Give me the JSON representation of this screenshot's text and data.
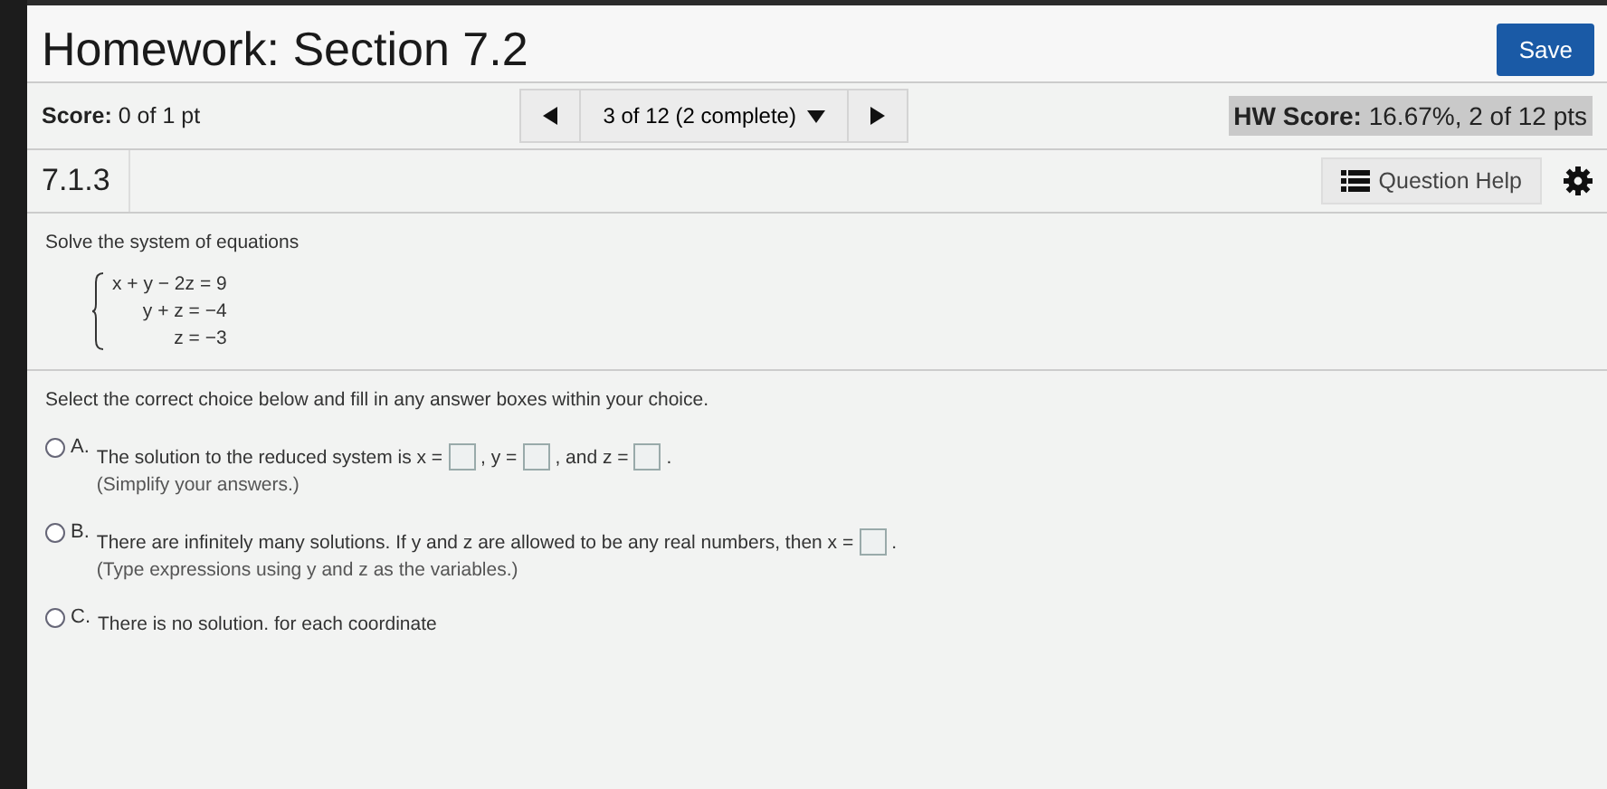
{
  "header": {
    "title": "Homework: Section 7.2",
    "save": "Save"
  },
  "score_bar": {
    "score_label": "Score:",
    "score_value": "0 of 1 pt",
    "navigator": "3 of 12 (2 complete)",
    "hw_score_label": "HW Score:",
    "hw_score_value": "16.67%, 2 of 12 pts"
  },
  "question_bar": {
    "number": "7.1.3",
    "help": "Question Help"
  },
  "question": {
    "instruction": "Solve the system of equations",
    "equations": [
      "x + y − 2z = 9",
      "y + z = −4",
      "z = −3"
    ],
    "prompt": "Select the correct choice below and fill in any answer boxes within your choice.",
    "choices": [
      {
        "letter": "A.",
        "selected": false,
        "parts": [
          {
            "kind": "text",
            "text": "The solution to the reduced system is x ="
          },
          {
            "kind": "box"
          },
          {
            "kind": "text",
            "text": ", y ="
          },
          {
            "kind": "box"
          },
          {
            "kind": "text",
            "text": ", and z ="
          },
          {
            "kind": "box"
          },
          {
            "kind": "text",
            "text": "."
          }
        ],
        "note": "(Simplify your answers.)"
      },
      {
        "letter": "B.",
        "selected": false,
        "parts": [
          {
            "kind": "text",
            "text": "There are infinitely many solutions. If y and z are allowed to be any real numbers, then x ="
          },
          {
            "kind": "box"
          },
          {
            "kind": "text",
            "text": "."
          }
        ],
        "note": "(Type expressions using y and z as the variables.)"
      },
      {
        "letter": "C.",
        "selected": false,
        "parts": [
          {
            "kind": "text",
            "text": "There is no solution. for each coordinate"
          }
        ]
      }
    ]
  }
}
